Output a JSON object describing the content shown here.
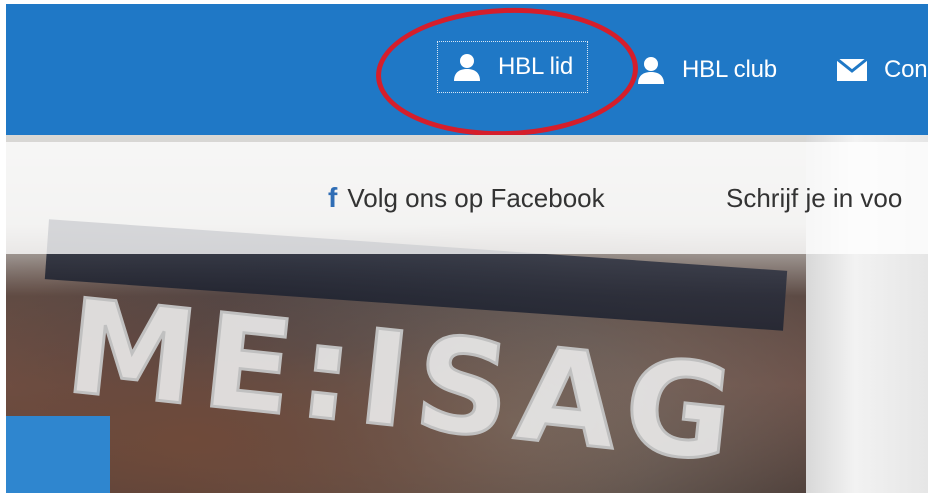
{
  "topnav": {
    "items": [
      {
        "label": "HBL lid",
        "icon": "user-icon"
      },
      {
        "label": "HBL club",
        "icon": "user-icon"
      },
      {
        "label": "Con",
        "icon": "envelope-icon"
      }
    ]
  },
  "social_bar": {
    "facebook_label": "Volg ons op Facebook",
    "facebook_icon": "facebook-icon",
    "newsletter_label": "Schrijf je in voo"
  },
  "hero": {
    "graffiti_text": "ME:ISAG"
  },
  "colors": {
    "nav_blue": "#1f78c6",
    "highlight_red": "#d51e2b",
    "facebook_blue": "#2f6db5"
  }
}
